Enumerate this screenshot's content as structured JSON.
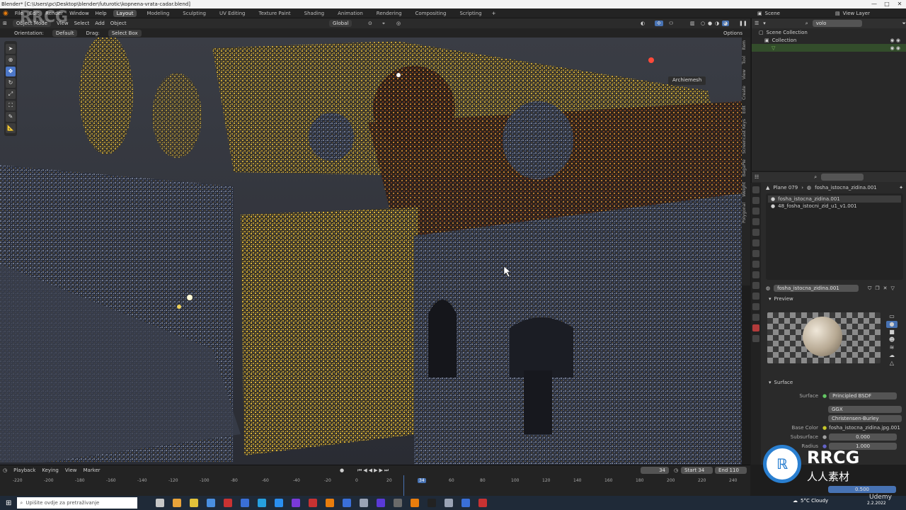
{
  "titlebar": {
    "title": "Blender* [C:\\Users\\pc\\Desktop\\blender\\futurotic\\kopnena-vrata-cadar.blend]",
    "minimize": "—",
    "maximize": "□",
    "close": "✕"
  },
  "menubar": {
    "menus": [
      "File",
      "Edit",
      "Render",
      "Window",
      "Help"
    ],
    "workspaces": [
      "Layout",
      "Modeling",
      "Sculpting",
      "UV Editing",
      "Texture Paint",
      "Shading",
      "Animation",
      "Rendering",
      "Compositing",
      "Scripting"
    ],
    "active_workspace": "Layout",
    "add_tab": "+",
    "scene": "Scene",
    "view_layer": "View Layer"
  },
  "viewport_header": {
    "mode": "Object Mode",
    "menus": [
      "View",
      "Select",
      "Add",
      "Object"
    ],
    "orientation_label": "Orientation:",
    "orientation": "Default",
    "drag_label": "Drag:",
    "drag": "Select Box",
    "transform": "Global",
    "options": "Options"
  },
  "viewport": {
    "archiemesh_button": "Archiemesh"
  },
  "toolbar_icons": [
    "select-icon",
    "cursor-icon",
    "move-icon",
    "rotate-icon",
    "scale-icon",
    "transform-icon",
    "annotate-icon",
    "measure-icon"
  ],
  "side_tabs": [
    "Item",
    "Tool",
    "View",
    "Create",
    "Edit",
    "Screencast Keys",
    "BagaPie",
    "Weight",
    "Polygonal"
  ],
  "outliner": {
    "search_value": "volo",
    "items": [
      {
        "label": "Scene Collection",
        "selected": false
      },
      {
        "label": "Collection",
        "selected": false
      },
      {
        "label": "",
        "selected": true
      }
    ]
  },
  "properties": {
    "object_name": "Plane 079",
    "material_link": "fosha_istocna_zidina.001",
    "slots": [
      "fosha_istocna_zidina.001",
      "48_fosha_istocni_zid_u1_v1.001"
    ],
    "material_name": "fosha_istocna_zidina.001",
    "preview_label": "Preview",
    "surface_label": "Surface",
    "fields": [
      {
        "label": "Surface",
        "value": "Principled BSDF"
      },
      {
        "label": "",
        "value": "GGX"
      },
      {
        "label": "",
        "value": "Christensen-Burley"
      },
      {
        "label": "Base Color",
        "value": "fosha_istocna_zidina.jpg.001"
      },
      {
        "label": "Subsurface",
        "value": "0.000"
      },
      {
        "label": "Radius",
        "value": "1.000"
      }
    ],
    "slider_bottom": "0.500"
  },
  "timeline": {
    "menus": [
      "Playback",
      "Keying",
      "View",
      "Marker"
    ],
    "current_frame": "34",
    "start_label": "Start",
    "start": "34",
    "end_label": "End",
    "end": "110",
    "ticks": [
      "-220",
      "-200",
      "-180",
      "-160",
      "-140",
      "-120",
      "-100",
      "-80",
      "-60",
      "-40",
      "-20",
      "0",
      "20",
      "34",
      "60",
      "80",
      "100",
      "120",
      "140",
      "160",
      "180",
      "200",
      "220",
      "240"
    ]
  },
  "taskbar": {
    "search_placeholder": "Upišite ovdje za pretraživanje",
    "weather": "5°C  Cloudy",
    "time": "2.2.2022"
  },
  "watermark": {
    "brand": "RRCG",
    "sub": "人人素材",
    "udemy": "Udemy"
  }
}
